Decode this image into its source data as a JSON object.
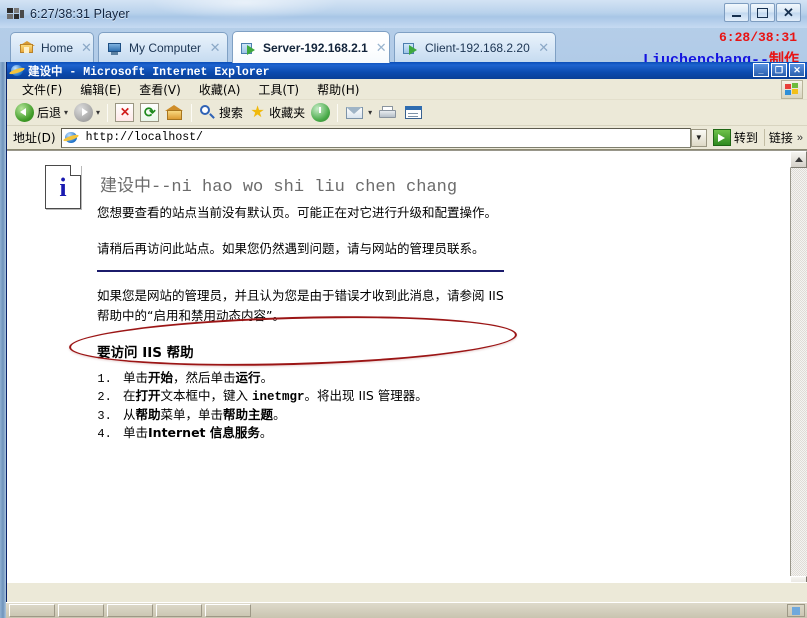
{
  "player": {
    "title": "6:27/38:31 Player",
    "icon": "vmware-icon",
    "window_controls": {
      "minimize": "–",
      "maximize": "□",
      "close": "✕"
    }
  },
  "tabs": [
    {
      "label": "Home",
      "icon": "home-icon",
      "close": "✕",
      "active": false
    },
    {
      "label": "My Computer",
      "icon": "monitor-icon",
      "close": "✕",
      "active": false
    },
    {
      "label": "Server-192.168.2.1",
      "icon": "vm-server-icon",
      "close": "✕",
      "active": true
    },
    {
      "label": "Client-192.168.2.20",
      "icon": "vm-client-icon",
      "close": "✕",
      "active": false
    }
  ],
  "overlay": {
    "time": "6:28/38:31",
    "author_latin": "Liuchenchang--",
    "author_cn": "制作",
    "time_color": "#e81414",
    "author_color": "#1414e0",
    "author_cn_color": "#e81414"
  },
  "ie": {
    "title": "建设中 - Microsoft Internet Explorer",
    "icon": "internet-explorer-icon",
    "window_controls": {
      "minimize": "_",
      "restore": "❐",
      "close": "✕"
    },
    "menu": [
      {
        "label": "文件(F)"
      },
      {
        "label": "编辑(E)"
      },
      {
        "label": "查看(V)"
      },
      {
        "label": "收藏(A)"
      },
      {
        "label": "工具(T)"
      },
      {
        "label": "帮助(H)"
      }
    ],
    "menu_logo": "windows-flag-icon",
    "toolbar": {
      "back": "后退",
      "back_dropdown": "▾",
      "forward_dropdown": "▾",
      "stop": "stop-icon",
      "refresh": "refresh-icon",
      "home": "home-icon",
      "search": "搜索",
      "favorites": "收藏夹",
      "history": "history-icon",
      "mail": "mail-icon",
      "mail_dropdown": "▾",
      "print": "print-icon",
      "edit": "edit-icon"
    },
    "address": {
      "label": "地址(D)",
      "url": "http://localhost/",
      "dropdown": "▼",
      "go": "转到",
      "links": "链接",
      "links_chevron": "»"
    },
    "scrollbar": {
      "up": "▲",
      "down": "▼"
    }
  },
  "page": {
    "info_icon": "information-icon",
    "info_glyph": "i",
    "heading": "建设中--ni hao wo shi liu chen chang",
    "annotation": "red-ellipse-highlight",
    "annotation_color": "#9b1515",
    "paragraph1": "您想要查看的站点当前没有默认页。可能正在对它进行升级和配置操作。",
    "paragraph2": "请稍后再访问此站点。如果您仍然遇到问题，请与网站的管理员联系。",
    "rule_color": "#1b1b6b",
    "paragraph3_a": "如果您是网站的管理员，并且认为您是由于错误才收到此消息，请参阅 IIS",
    "paragraph3_b": "帮助中的“启用和禁用动态内容”。",
    "subheading": "要访问 IIS 帮助",
    "steps": [
      {
        "pre": "单击",
        "b1": "开始",
        "mid": "，然后单击",
        "b2": "运行",
        "post": "。"
      },
      {
        "pre": "在",
        "b1": "打开",
        "mid": "文本框中，键入 ",
        "mono": "inetmgr",
        "post": "。将出现 IIS 管理器。"
      },
      {
        "pre": "从",
        "b1": "帮助",
        "mid": "菜单，单击",
        "b2": "帮助主题",
        "post": "。"
      },
      {
        "pre": "单击",
        "b1": "Internet 信息服务",
        "post": "。"
      }
    ]
  }
}
